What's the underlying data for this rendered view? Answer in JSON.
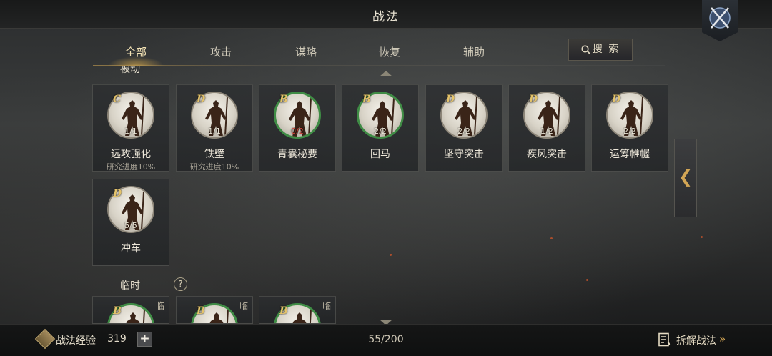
{
  "header": {
    "title": "战法"
  },
  "tabs": [
    {
      "label": "全部",
      "active": true
    },
    {
      "label": "攻击",
      "active": false
    },
    {
      "label": "谋略",
      "active": false
    },
    {
      "label": "恢复",
      "active": false
    },
    {
      "label": "辅助",
      "active": false
    }
  ],
  "search": {
    "label": "搜 索"
  },
  "sections": {
    "passive": {
      "label": "被动"
    },
    "temporary": {
      "label": "临时",
      "help": "?"
    }
  },
  "passive_cards": [
    {
      "grade": "C",
      "count": "1/1",
      "name": "远攻强化",
      "sub": "研究进度10%",
      "ring": "plain",
      "count_color": "normal"
    },
    {
      "grade": "D",
      "count": "1/1",
      "name": "铁壁",
      "sub": "研究进度10%",
      "ring": "plain",
      "count_color": "normal"
    },
    {
      "grade": "B",
      "count": "0/2",
      "name": "青囊秘要",
      "sub": "",
      "ring": "green",
      "count_color": "red"
    },
    {
      "grade": "B",
      "count": "2/2",
      "name": "回马",
      "sub": "",
      "ring": "green",
      "count_color": "normal"
    },
    {
      "grade": "D",
      "count": "2/2",
      "name": "坚守突击",
      "sub": "",
      "ring": "plain",
      "count_color": "normal"
    },
    {
      "grade": "D",
      "count": "1/2",
      "name": "疾风突击",
      "sub": "",
      "ring": "plain",
      "count_color": "normal"
    },
    {
      "grade": "D",
      "count": "2/2",
      "name": "运筹帷幄",
      "sub": "",
      "ring": "plain",
      "count_color": "normal"
    },
    {
      "grade": "D",
      "count": "5/5",
      "name": "冲车",
      "sub": "",
      "ring": "plain",
      "count_color": "normal"
    }
  ],
  "temp_cards": [
    {
      "grade": "B",
      "tag": "临"
    },
    {
      "grade": "B",
      "tag": "临"
    },
    {
      "grade": "B",
      "tag": "临"
    }
  ],
  "side_handle": {
    "glyph": "❮"
  },
  "footer": {
    "exp_label": "战法经验",
    "exp_value": "319",
    "plus": "+",
    "capacity": "55/200",
    "decompose_label": "拆解战法",
    "decompose_arrows": "»"
  },
  "colors": {
    "accent_gold": "#d3a655",
    "ring_green": "#3f8c45",
    "count_red": "#d8473c"
  }
}
